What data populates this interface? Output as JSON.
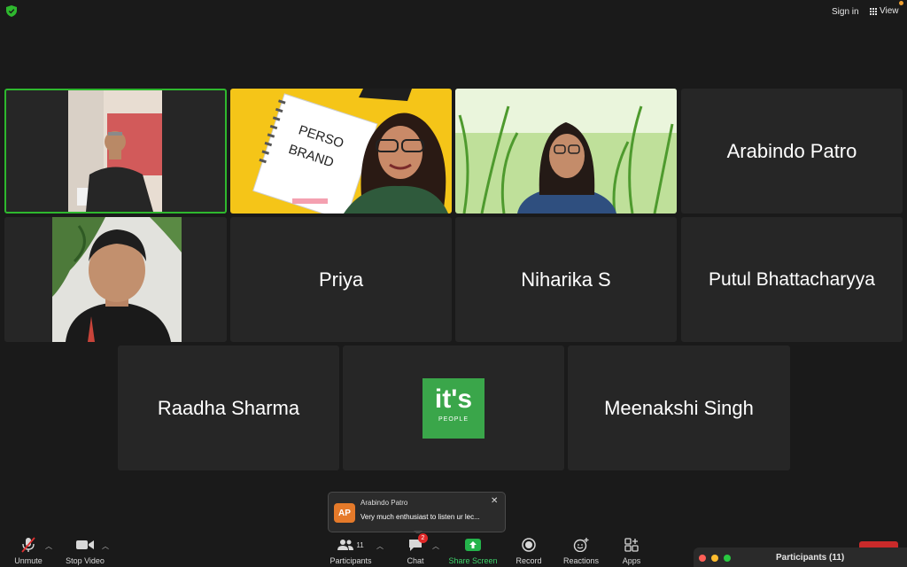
{
  "topbar": {
    "sign_in": "Sign in",
    "view": "View"
  },
  "tiles": [
    {
      "name": "",
      "type": "video",
      "active": true
    },
    {
      "name": "",
      "type": "video"
    },
    {
      "name": "",
      "type": "video"
    },
    {
      "name": "Arabindo Patro",
      "type": "name"
    },
    {
      "name": "",
      "type": "video"
    },
    {
      "name": "Priya",
      "type": "name"
    },
    {
      "name": "Niharika S",
      "type": "name"
    },
    {
      "name": "Putul Bhattacharyya",
      "type": "name"
    },
    {
      "name": "Raadha Sharma",
      "type": "name"
    },
    {
      "name": "",
      "type": "logo"
    },
    {
      "name": "Meenakshi Singh",
      "type": "name"
    }
  ],
  "video_text": {
    "notebook_line1": "PERSO",
    "notebook_line2": "BRAND"
  },
  "logo": {
    "main": "it's",
    "sub": "PEOPLE",
    "bg": "#3aa64a"
  },
  "toast": {
    "initials": "AP",
    "sender": "Arabindo Patro",
    "message": "Very much enthusiast to listen ur lec..."
  },
  "toolbar": {
    "unmute": "Unmute",
    "stop_video": "Stop Video",
    "participants": "Participants",
    "participants_count": "11",
    "chat": "Chat",
    "chat_badge": "2",
    "share_screen": "Share Screen",
    "record": "Record",
    "reactions": "Reactions",
    "apps": "Apps"
  },
  "participants_panel": {
    "title": "Participants (11)"
  },
  "colors": {
    "active_border": "#2eb82e",
    "share_green": "#24b34b",
    "badge_red": "#e02828"
  }
}
